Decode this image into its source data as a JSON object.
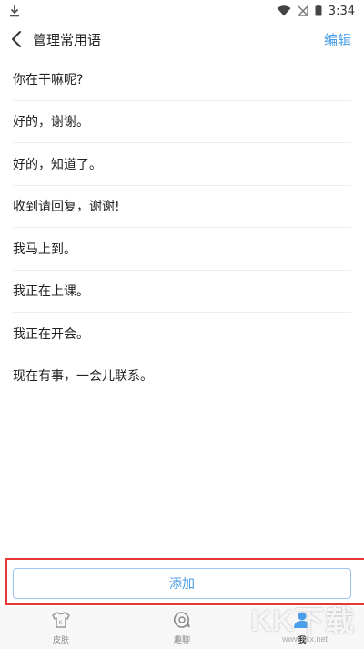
{
  "status_bar": {
    "time": "3:34",
    "icons": [
      "download-icon",
      "wifi-icon",
      "no-signal-icon",
      "battery-icon"
    ]
  },
  "nav": {
    "title": "管理常用语",
    "edit_label": "编辑",
    "back_icon": "chevron-left-icon"
  },
  "phrases": [
    "你在干嘛呢?",
    "好的，谢谢。",
    "好的，知道了。",
    "收到请回复，谢谢!",
    "我马上到。",
    "我正在上课。",
    "我正在开会。",
    "现在有事，一会儿联系。"
  ],
  "add_label": "添加",
  "tabs": [
    {
      "label": "皮肤",
      "icon": "tshirt-icon"
    },
    {
      "label": "趣聊",
      "icon": "chat-icon"
    },
    {
      "label": "我",
      "icon": "user-icon",
      "active": true
    }
  ],
  "watermark": {
    "logo": "KK下载",
    "url": "www.kkx.net"
  },
  "colors": {
    "accent": "#4a9ee8",
    "highlight": "#e53935",
    "divider": "#eeeeee"
  }
}
